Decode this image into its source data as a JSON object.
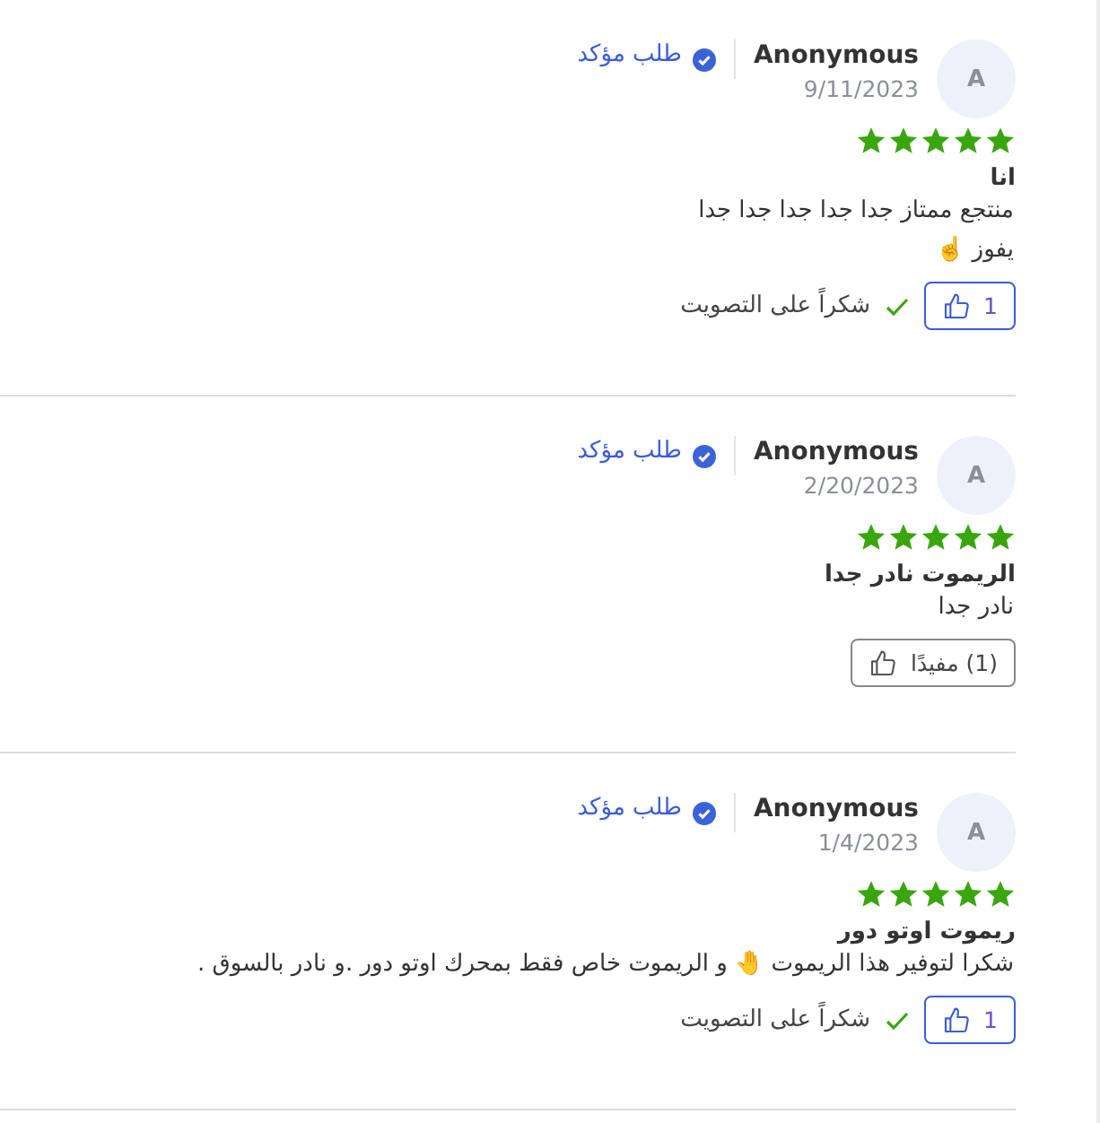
{
  "reviews": [
    {
      "avatar": "A",
      "name": "Anonymous",
      "date": "9/11/2023",
      "verified": "طلب مؤكد",
      "stars": 5,
      "title": "انا",
      "body": [
        "منتجع ممتاز جدا جدا جدا جدا جدا",
        "يفوز ☝️"
      ],
      "helpful": {
        "label": "1",
        "voted": true,
        "thanks": "شكراً على التصويت"
      }
    },
    {
      "avatar": "A",
      "name": "Anonymous",
      "date": "2/20/2023",
      "verified": "طلب مؤكد",
      "stars": 5,
      "title": "الريموت نادر جدا",
      "body": [
        "نادر جدا"
      ],
      "helpful": {
        "label": "(1) مفيدًا",
        "voted": false
      }
    },
    {
      "avatar": "A",
      "name": "Anonymous",
      "date": "1/4/2023",
      "verified": "طلب مؤكد",
      "stars": 5,
      "title": "ريموت اوتو دور",
      "body": [
        "شكرا لتوفير هذا الريموت 🤚 و الريموت خاص فقط بمحرك اوتو دور .و نادر بالسوق ."
      ],
      "helpful": {
        "label": "1",
        "voted": true,
        "thanks": "شكراً على التصويت"
      }
    }
  ]
}
